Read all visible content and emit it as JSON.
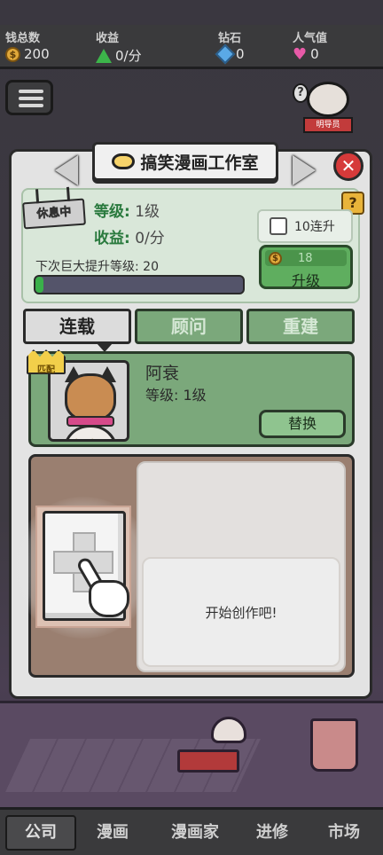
{
  "stats": {
    "money_label": "钱总数",
    "money_value": "200",
    "income_label": "收益",
    "income_value": "0/分",
    "diamond_label": "钻石",
    "diamond_value": "0",
    "popularity_label": "人气值",
    "popularity_value": "0"
  },
  "guide": {
    "question": "?",
    "tag": "明导员"
  },
  "studio": {
    "title": "搞笑漫画工作室",
    "status_sign": "休息中",
    "level_label": "等级:",
    "level_value": "1级",
    "income_label": "收益:",
    "income_value": "0/分",
    "help": "?",
    "ten_upgrade_label": "10连升",
    "upgrade_cost": "18",
    "upgrade_label": "升级",
    "next_big_upgrade": "下次巨大提升等级: 20",
    "progress_fraction": 0.04
  },
  "tabs": [
    {
      "label": "连载",
      "active": true
    },
    {
      "label": "顾问",
      "active": false
    },
    {
      "label": "重建",
      "active": false
    }
  ],
  "artist": {
    "badge": "匹配",
    "name": "阿衰",
    "level": "等级: 1级",
    "replace_label": "替换"
  },
  "creation": {
    "prompt": "开始创作吧!"
  },
  "bottom_nav": [
    {
      "label": "公司",
      "active": true
    },
    {
      "label": "漫画",
      "active": false
    },
    {
      "label": "漫画家",
      "active": false
    },
    {
      "label": "进修",
      "active": false
    },
    {
      "label": "市场",
      "active": false
    }
  ],
  "colors": {
    "accent_green": "#3ab04a",
    "close_red": "#d63a3a",
    "coin_gold": "#e0a83a"
  }
}
